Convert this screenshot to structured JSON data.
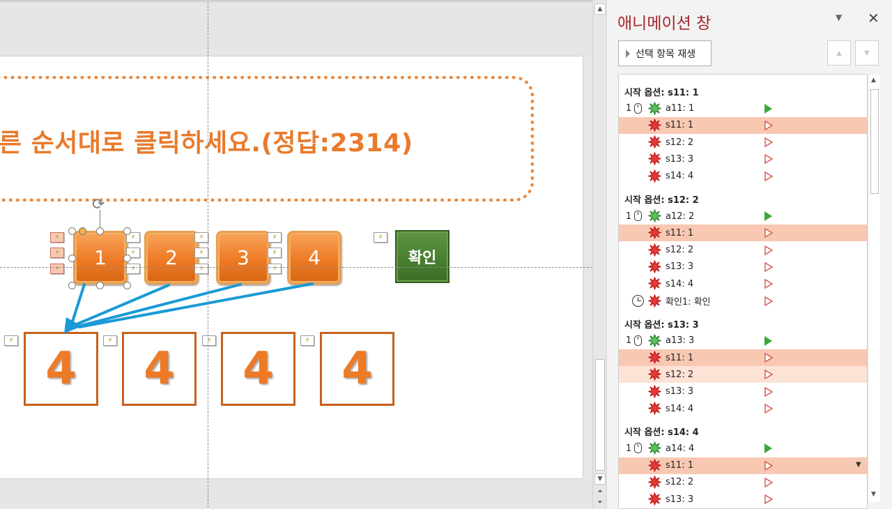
{
  "slide": {
    "title_text": "른 순서대로 클릭하세요.(정답:2314)",
    "number_buttons": [
      "1",
      "2",
      "3",
      "4"
    ],
    "confirm_label": "확인",
    "answer_boxes": [
      "4",
      "4",
      "4",
      "4"
    ],
    "tag_glyph": "⚡"
  },
  "pane": {
    "title": "애니메이션 창",
    "dropdown_glyph": "▼",
    "close_glyph": "✕",
    "play_label": "선택 항목 재생",
    "move_up_glyph": "▲",
    "move_down_glyph": "▼",
    "groups": [
      {
        "header": "시작 옵션: s11: 1",
        "rows": [
          {
            "idx": "1",
            "icon": "mouse",
            "star": "green",
            "label": "a11: 1",
            "play": "green",
            "state": ""
          },
          {
            "idx": "",
            "icon": "",
            "star": "red",
            "label": "s11: 1",
            "play": "red",
            "state": "sel"
          },
          {
            "idx": "",
            "icon": "",
            "star": "red",
            "label": "s12: 2",
            "play": "red",
            "state": ""
          },
          {
            "idx": "",
            "icon": "",
            "star": "red",
            "label": "s13: 3",
            "play": "red",
            "state": ""
          },
          {
            "idx": "",
            "icon": "",
            "star": "red",
            "label": "s14: 4",
            "play": "red",
            "state": ""
          }
        ]
      },
      {
        "header": "시작 옵션: s12: 2",
        "rows": [
          {
            "idx": "1",
            "icon": "mouse",
            "star": "green",
            "label": "a12: 2",
            "play": "green",
            "state": ""
          },
          {
            "idx": "",
            "icon": "",
            "star": "red",
            "label": "s11: 1",
            "play": "red",
            "state": "sel"
          },
          {
            "idx": "",
            "icon": "",
            "star": "red",
            "label": "s12: 2",
            "play": "red",
            "state": ""
          },
          {
            "idx": "",
            "icon": "",
            "star": "red",
            "label": "s13: 3",
            "play": "red",
            "state": ""
          },
          {
            "idx": "",
            "icon": "",
            "star": "red",
            "label": "s14: 4",
            "play": "red",
            "state": ""
          },
          {
            "idx": "",
            "icon": "clock",
            "star": "red",
            "label": "확인1: 확인",
            "play": "red",
            "state": ""
          }
        ]
      },
      {
        "header": "시작 옵션: s13: 3",
        "rows": [
          {
            "idx": "1",
            "icon": "mouse",
            "star": "green",
            "label": "a13: 3",
            "play": "green",
            "state": ""
          },
          {
            "idx": "",
            "icon": "",
            "star": "red",
            "label": "s11: 1",
            "play": "red",
            "state": "sel"
          },
          {
            "idx": "",
            "icon": "",
            "star": "red",
            "label": "s12: 2",
            "play": "red",
            "state": "sel2"
          },
          {
            "idx": "",
            "icon": "",
            "star": "red",
            "label": "s13: 3",
            "play": "red",
            "state": ""
          },
          {
            "idx": "",
            "icon": "",
            "star": "red",
            "label": "s14: 4",
            "play": "red",
            "state": ""
          }
        ]
      },
      {
        "header": "시작 옵션: s14: 4",
        "rows": [
          {
            "idx": "1",
            "icon": "mouse",
            "star": "green",
            "label": "a14: 4",
            "play": "green",
            "state": ""
          },
          {
            "idx": "",
            "icon": "",
            "star": "red",
            "label": "s11: 1",
            "play": "red",
            "state": "sel"
          },
          {
            "idx": "",
            "icon": "",
            "star": "red",
            "label": "s12: 2",
            "play": "red",
            "state": ""
          },
          {
            "idx": "",
            "icon": "",
            "star": "red",
            "label": "s13: 3",
            "play": "red",
            "state": ""
          }
        ]
      }
    ]
  },
  "colors": {
    "accent_orange": "#ee7a26",
    "pane_title": "#a4262c",
    "selected_row": "#f8c8b3",
    "confirm_green": "#3b6f25",
    "arrow_blue": "#1a9ad6"
  }
}
